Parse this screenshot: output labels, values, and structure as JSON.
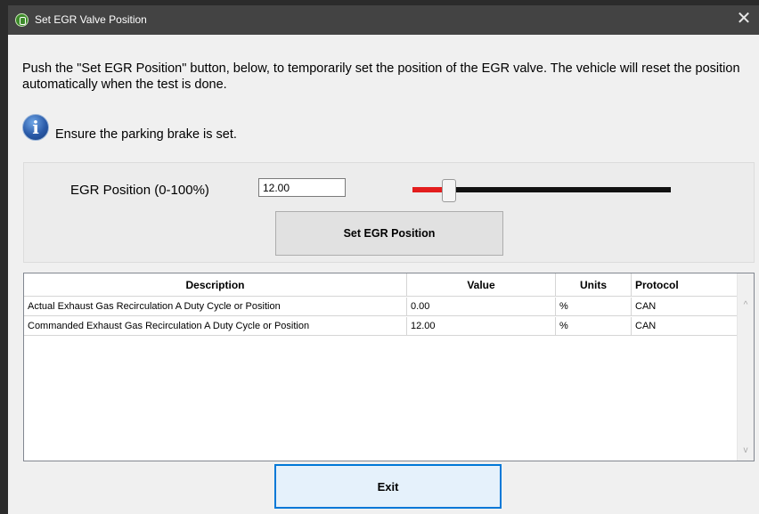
{
  "window": {
    "title": "Set EGR Valve Position",
    "close_symbol": "✕",
    "icon": "app-logo-icon"
  },
  "intro_text": "Push the \"Set EGR Position\" button, below, to temporarily set the position of the EGR valve.  The vehicle will reset the position automatically when the test is done.",
  "info": {
    "icon": "info-icon",
    "glyph": "i",
    "text": "Ensure the parking brake is set."
  },
  "egr": {
    "label": "EGR Position (0-100%)",
    "value": "12.00",
    "slider_percent": 12,
    "slider_colors": {
      "fill": "#e31d1d",
      "track": "#111111"
    },
    "set_button_label": "Set EGR Position"
  },
  "table": {
    "columns": [
      "Description",
      "Value",
      "Units",
      "Protocol"
    ],
    "rows": [
      {
        "description": "Actual Exhaust Gas Recirculation A Duty Cycle or Position",
        "value": "0.00",
        "units": "%",
        "protocol": "CAN"
      },
      {
        "description": "Commanded Exhaust Gas Recirculation A Duty Cycle or Position",
        "value": "12.00",
        "units": "%",
        "protocol": "CAN"
      }
    ],
    "scroll_up": "^",
    "scroll_down": "v"
  },
  "exit_button_label": "Exit",
  "colors": {
    "titlebar": "#434343",
    "focus_border": "#0078d7"
  }
}
